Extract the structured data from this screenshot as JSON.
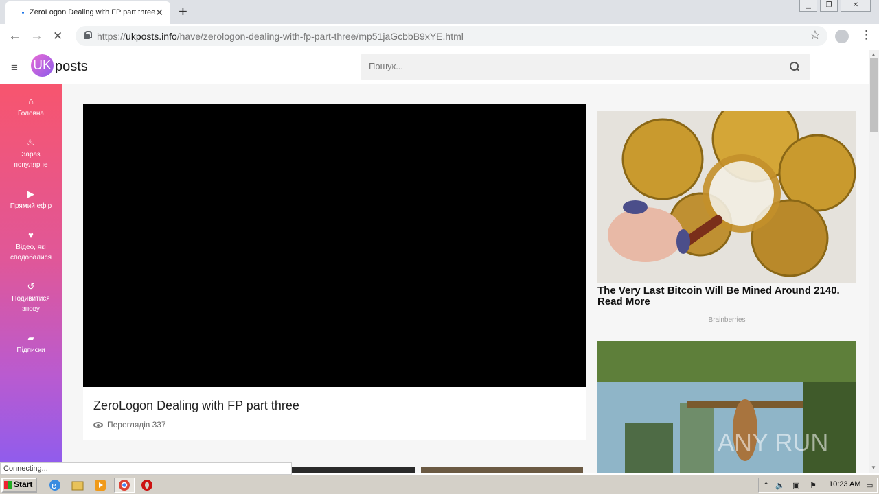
{
  "browser": {
    "tab_title": "ZeroLogon Dealing with FP part three",
    "tab_close": "✕",
    "new_tab": "+",
    "url_scheme": "https://",
    "url_host": "ukposts.info",
    "url_path": "/have/zerologon-dealing-with-fp-part-three/mp51jaGcbbB9xYE.html",
    "back": "←",
    "forward": "→",
    "stop": "✕",
    "bookmark_star": "☆",
    "menu": "⋮",
    "status": "Connecting..."
  },
  "site": {
    "logo_badge": "UK",
    "logo_text": "posts",
    "search_placeholder": "Пошук...",
    "sidebar": [
      {
        "icon": "⌂",
        "label": "Головна"
      },
      {
        "icon": "♨",
        "label": "Зараз популярне"
      },
      {
        "icon": "▶",
        "label": "Прямий ефір"
      },
      {
        "icon": "♥",
        "label": "Відео, які сподобалися"
      },
      {
        "icon": "↺",
        "label": "Подивитися знову"
      },
      {
        "icon": "▰",
        "label": "Підписки"
      }
    ]
  },
  "video": {
    "title": "ZeroLogon Dealing with FP part three",
    "views": "Переглядів 337"
  },
  "ads": [
    {
      "title": "The Very Last Bitcoin Will Be Mined Around 2140. Read More",
      "source": "Brainberries"
    },
    {
      "title": "",
      "source": ""
    }
  ],
  "taskbar": {
    "start": "Start",
    "clock": "10:23 AM"
  },
  "colors": {
    "sidebar_top": "#f7556e",
    "sidebar_bottom": "#8b5cf0",
    "logo_pink": "#e86bd5"
  }
}
